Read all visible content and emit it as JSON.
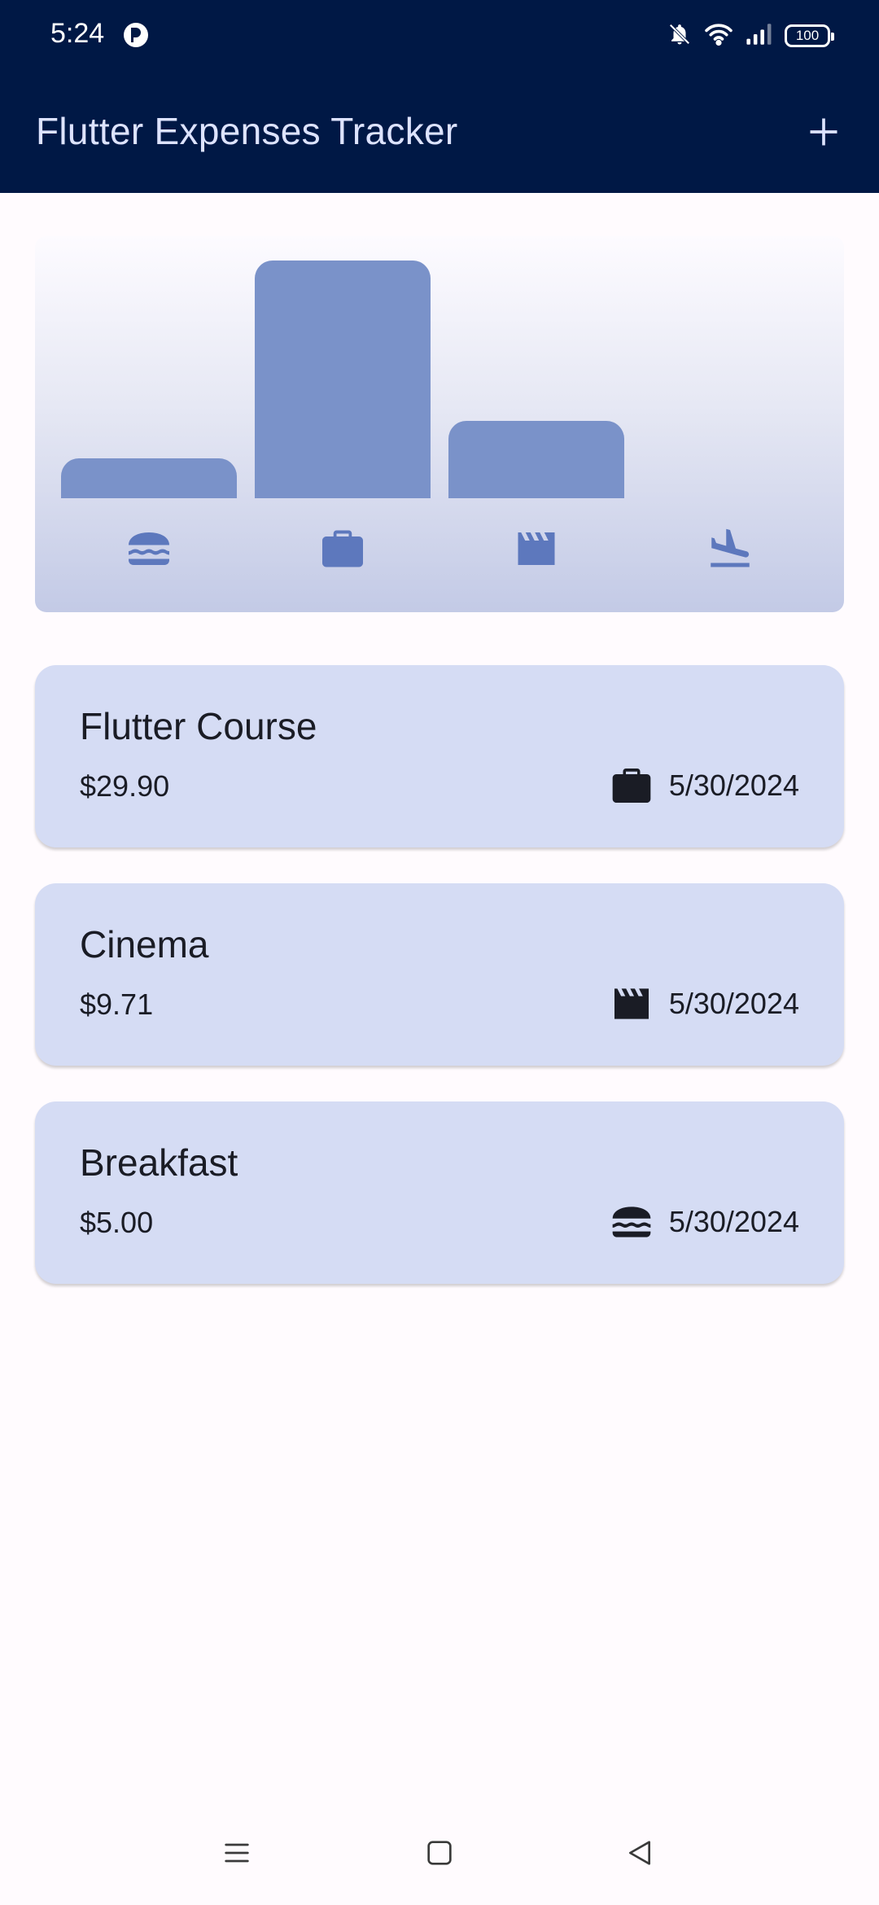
{
  "status_bar": {
    "time": "5:24",
    "battery": "100",
    "icons": [
      "app-notification-icon",
      "dnd-bell-off-icon",
      "wifi-icon",
      "signal-icon",
      "battery-icon"
    ]
  },
  "app_bar": {
    "title": "Flutter Expenses Tracker",
    "add_icon": "plus-icon"
  },
  "chart_data": {
    "type": "bar",
    "categories": [
      "food",
      "work",
      "leisure",
      "travel"
    ],
    "category_icons": [
      "burger-icon",
      "briefcase-icon",
      "clapperboard-icon",
      "flight-land-icon"
    ],
    "values": [
      5.0,
      29.9,
      9.71,
      0
    ],
    "ylim": [
      0,
      29.9
    ],
    "bar_color": "#7a92c9",
    "icon_color": "#5d78bd"
  },
  "expenses": [
    {
      "title": "Flutter Course",
      "amount": "$29.90",
      "date": "5/30/2024",
      "category_icon": "briefcase-icon"
    },
    {
      "title": "Cinema",
      "amount": "$9.71",
      "date": "5/30/2024",
      "category_icon": "clapperboard-icon"
    },
    {
      "title": "Breakfast",
      "amount": "$5.00",
      "date": "5/30/2024",
      "category_icon": "burger-icon"
    }
  ],
  "nav_bar": {
    "icons": [
      "menu-icon",
      "home-square-icon",
      "back-triangle-icon"
    ]
  },
  "colors": {
    "app_bar_bg": "#001845",
    "app_title": "#dde3ff",
    "card_bg": "#d5dcf4",
    "page_bg": "#fffbfe"
  }
}
